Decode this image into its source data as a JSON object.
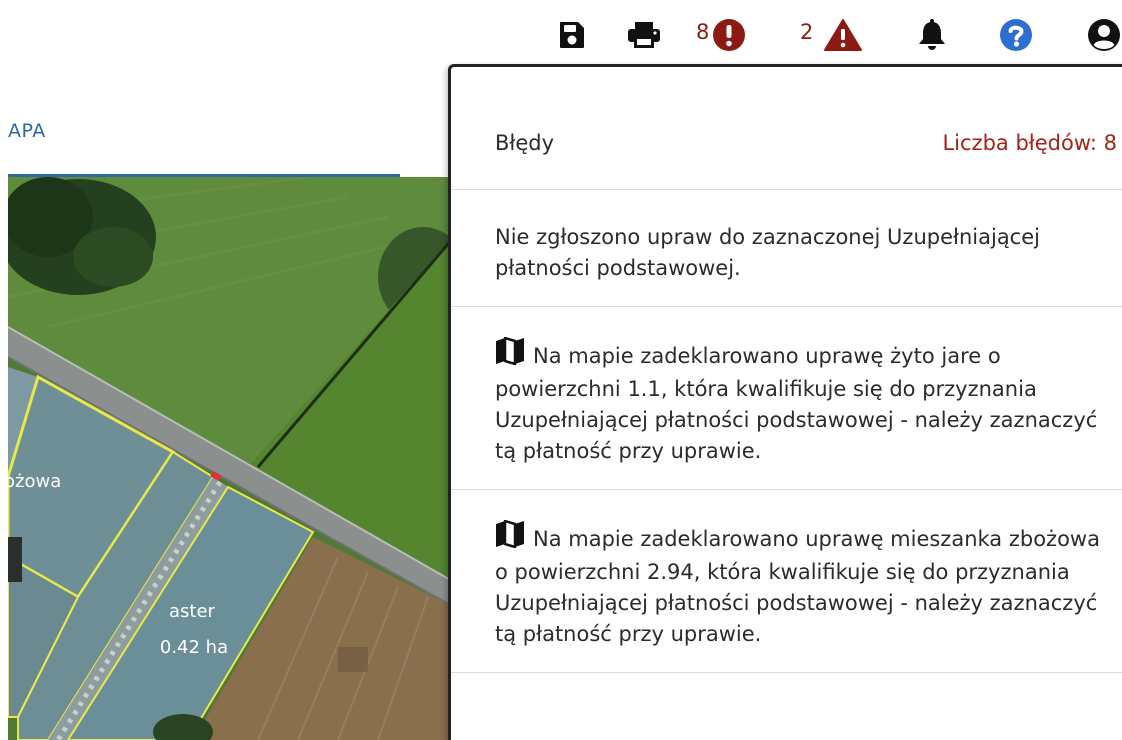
{
  "toolbar": {
    "icons": {
      "save": "save-icon",
      "print": "print-icon",
      "error": "exclamation-circle-icon",
      "warning": "warning-triangle-icon",
      "notifications": "bell-icon",
      "help": "question-circle-icon",
      "account": "user-circle-icon"
    },
    "error_count": "8",
    "warning_count": "2",
    "colors": {
      "icon_dark": "#111111",
      "error_red": "#8d1a12",
      "help_blue": "#2c6fd1"
    }
  },
  "map": {
    "tab_label": "APA",
    "parcel_labels": {
      "left_partial": "ożowa",
      "crop": "aster",
      "area": "0.42 ha"
    },
    "colors": {
      "tab_blue": "#2f66a8",
      "parcel_outline": "#e8e84a"
    }
  },
  "errors_panel": {
    "title": "Błędy",
    "count_label": "Liczba błędów: 8",
    "items": [
      {
        "has_map_icon": false,
        "text": "Nie zgłoszono upraw do zaznaczonej Uzupełniającej płatności podstawowej."
      },
      {
        "has_map_icon": true,
        "icon": "map-icon",
        "text": "Na mapie zadeklarowano uprawę żyto jare o powierzchni 1.1, która kwalifikuje się do przyznania Uzupełniającej płatności podstawowej - należy zaznaczyć tą płatność przy uprawie."
      },
      {
        "has_map_icon": true,
        "icon": "map-icon",
        "text": "Na mapie zadeklarowano uprawę mieszanka zbożowa o powierzchni 2.94, która kwalifikuje się do przyznania Uzupełniającej płatności podstawowej - należy zaznaczyć tą płatność przy uprawie."
      }
    ],
    "colors": {
      "count_red": "#a3231a"
    }
  }
}
